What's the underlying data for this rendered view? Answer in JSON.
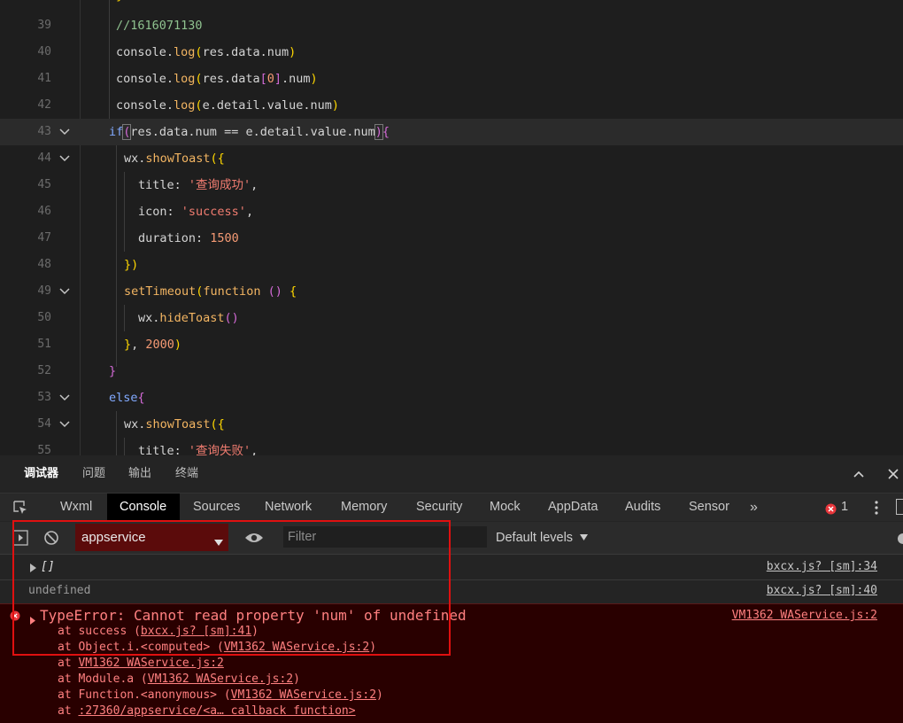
{
  "editor": {
    "lines": [
      {
        "n": "39",
        "text": "//1616071130"
      },
      {
        "n": "40",
        "text": "console.log(res.data.num)"
      },
      {
        "n": "41",
        "text": "console.log(res.data[0].num)"
      },
      {
        "n": "42",
        "text": "console.log(e.detail.value.num)"
      },
      {
        "n": "43",
        "text": "if(res.data.num == e.detail.value.num){"
      },
      {
        "n": "44",
        "text": "wx.showToast({"
      },
      {
        "n": "45",
        "text": "title: '查询成功',"
      },
      {
        "n": "46",
        "text": "icon: 'success',"
      },
      {
        "n": "47",
        "text": "duration: 1500"
      },
      {
        "n": "48",
        "text": "})"
      },
      {
        "n": "49",
        "text": "setTimeout(function () {"
      },
      {
        "n": "50",
        "text": "wx.hideToast()"
      },
      {
        "n": "51",
        "text": "}, 2000)"
      },
      {
        "n": "52",
        "text": "}"
      },
      {
        "n": "53",
        "text": "else{"
      },
      {
        "n": "54",
        "text": "wx.showToast({"
      },
      {
        "n": "55",
        "text": "title: '查询失败',"
      }
    ]
  },
  "devtools": {
    "top_tabs": [
      "调试器",
      "问题",
      "输出",
      "终端"
    ],
    "tool_tabs": [
      "Wxml",
      "Console",
      "Sources",
      "Network",
      "Memory",
      "Security",
      "Mock",
      "AppData",
      "Audits",
      "Sensor"
    ],
    "more_tabs": "»",
    "error_count": "1",
    "context": "appservice",
    "filter_placeholder": "Filter",
    "levels": "Default levels"
  },
  "console": {
    "row1": {
      "text": "[]",
      "source": "bxcx.js? [sm]:34"
    },
    "row2": {
      "text": "undefined",
      "source": "bxcx.js? [sm]:40"
    },
    "error": {
      "message": "TypeError: Cannot read property 'num' of undefined",
      "source": "VM1362 WAService.js:2",
      "stack": [
        {
          "prefix": "at success (",
          "link": "bxcx.js? [sm]:41",
          "suffix": ")"
        },
        {
          "prefix": "at Object.i.<computed> (",
          "link": "VM1362 WAService.js:2",
          "suffix": ")"
        },
        {
          "prefix": "at ",
          "link": "VM1362 WAService.js:2",
          "suffix": ""
        },
        {
          "prefix": "at Module.a (",
          "link": "VM1362 WAService.js:2",
          "suffix": ")"
        },
        {
          "prefix": "at Function.<anonymous> (",
          "link": "VM1362 WAService.js:2",
          "suffix": ")"
        },
        {
          "prefix": "at ",
          "link": ":27360/appservice/<a… callback function>",
          "suffix": ""
        }
      ]
    }
  },
  "colors": {
    "annotation_box": "#e01010",
    "error_background": "#290000",
    "context_select": "#5b0b0b"
  }
}
